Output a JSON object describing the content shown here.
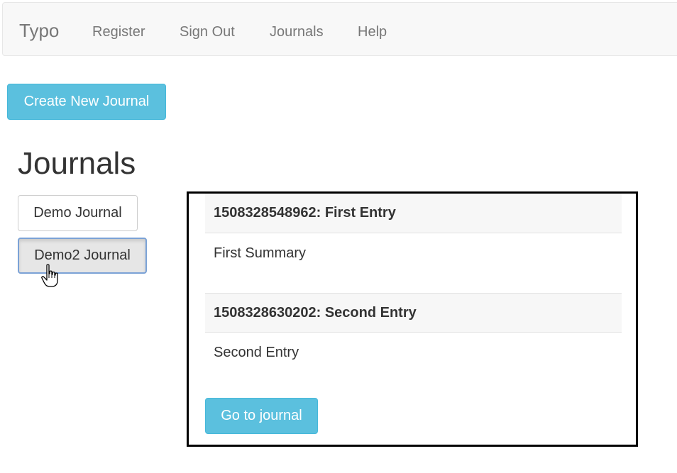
{
  "navbar": {
    "brand": "Typo",
    "links": [
      "Register",
      "Sign Out",
      "Journals",
      "Help"
    ]
  },
  "actions": {
    "create_label": "Create New Journal"
  },
  "main": {
    "title": "Journals",
    "journals": [
      {
        "label": "Demo Journal",
        "active": false
      },
      {
        "label": "Demo2 Journal",
        "active": true
      }
    ]
  },
  "panel": {
    "entries": [
      {
        "heading": "1508328548962: First Entry",
        "summary": "First Summary"
      },
      {
        "heading": "1508328630202: Second Entry",
        "summary": "Second Entry"
      }
    ],
    "goto_label": "Go to journal"
  },
  "colors": {
    "info": "#5bc0de",
    "navbar_bg": "#f8f8f8",
    "entry_head_bg": "#f7f7f7"
  },
  "icons": {
    "cursor": "hand-pointer-icon"
  }
}
